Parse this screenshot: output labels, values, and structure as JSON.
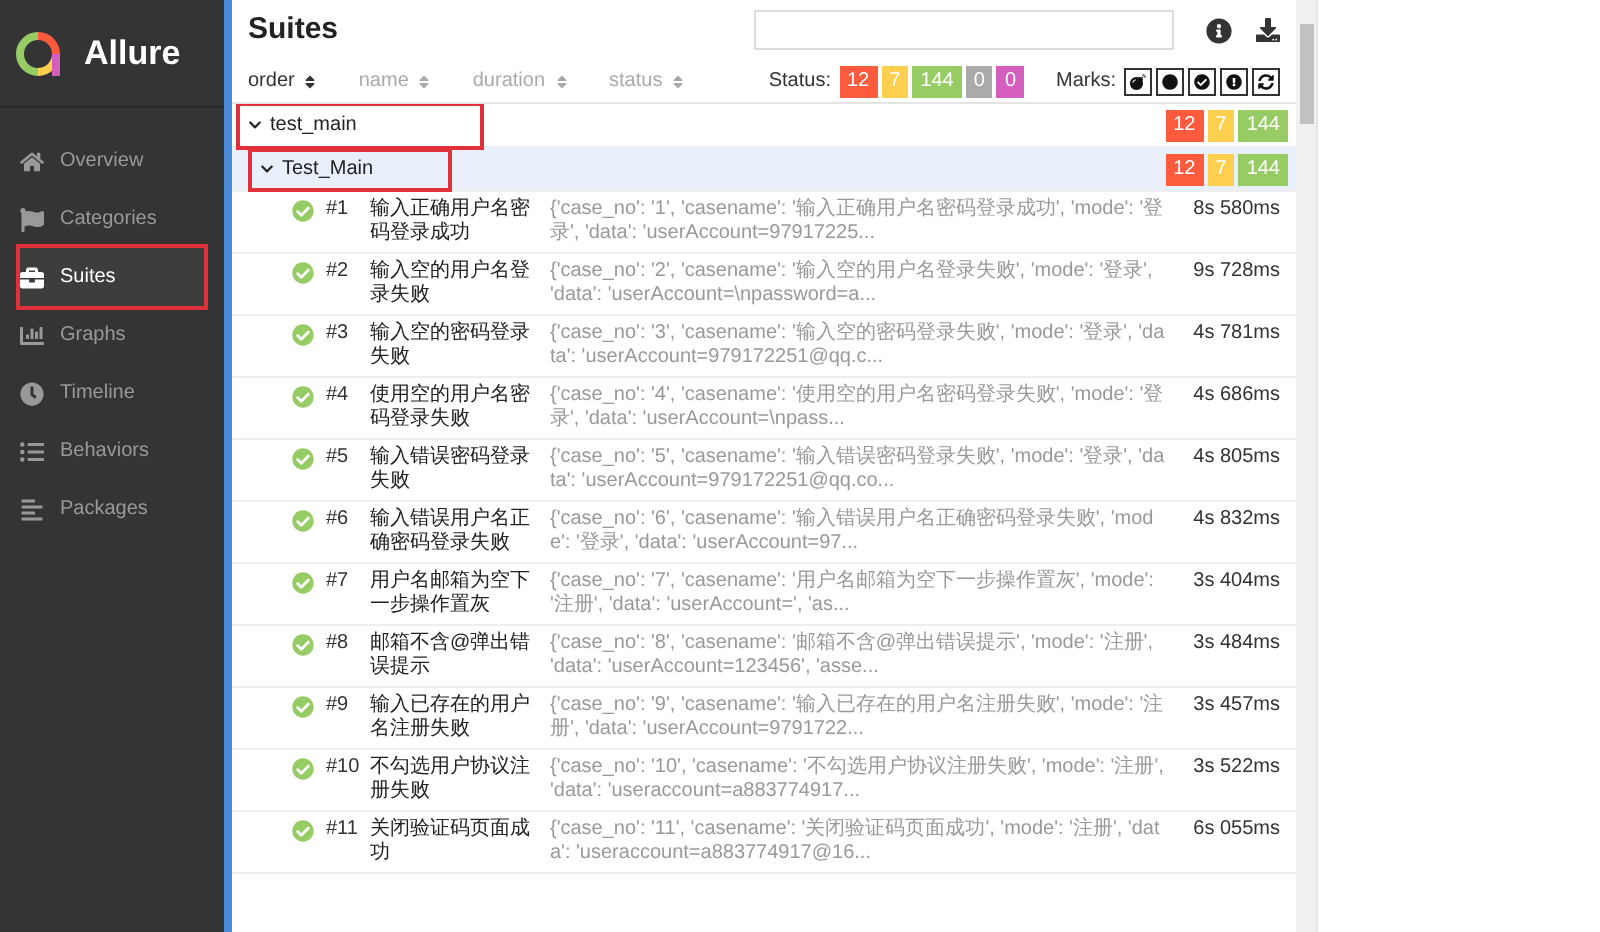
{
  "sidebar": {
    "logo": "Allure",
    "items": [
      {
        "label": "Overview",
        "selected": false,
        "annotated": false
      },
      {
        "label": "Categories",
        "selected": false,
        "annotated": false
      },
      {
        "label": "Suites",
        "selected": true,
        "annotated": true
      },
      {
        "label": "Graphs",
        "selected": false,
        "annotated": false
      },
      {
        "label": "Timeline",
        "selected": false,
        "annotated": false
      },
      {
        "label": "Behaviors",
        "selected": false,
        "annotated": false
      },
      {
        "label": "Packages",
        "selected": false,
        "annotated": false
      }
    ]
  },
  "title": "Suites",
  "sort_columns": [
    {
      "label": "order",
      "active": true
    },
    {
      "label": "name",
      "active": false
    },
    {
      "label": "duration",
      "active": false
    },
    {
      "label": "status",
      "active": false
    }
  ],
  "status_filter": {
    "label": "Status:",
    "counts": [
      {
        "value": "12",
        "kind": "failed"
      },
      {
        "value": "7",
        "kind": "broken"
      },
      {
        "value": "144",
        "kind": "passed"
      },
      {
        "value": "0",
        "kind": "skipped"
      },
      {
        "value": "0",
        "kind": "unknown"
      }
    ]
  },
  "marks": {
    "label": "Marks:",
    "items": [
      {
        "kind": "flaky"
      },
      {
        "kind": "new-failed"
      },
      {
        "kind": "new-passed"
      },
      {
        "kind": "new-broken"
      },
      {
        "kind": "retries"
      }
    ]
  },
  "tree": [
    {
      "name": "test_main",
      "expanded": true,
      "annotated": true,
      "counts": [
        {
          "value": "12",
          "kind": "failed"
        },
        {
          "value": "7",
          "kind": "broken"
        },
        {
          "value": "144",
          "kind": "passed"
        }
      ],
      "children": [
        {
          "name": "Test_Main",
          "expanded": true,
          "annotated": true,
          "counts": [
            {
              "value": "12",
              "kind": "failed"
            },
            {
              "value": "7",
              "kind": "broken"
            },
            {
              "value": "144",
              "kind": "passed"
            }
          ],
          "cases": [
            {
              "number": "#1",
              "kind": "passed",
              "title": "输入正确用户名密码登录成功",
              "description": "{'case_no': '1', 'casename': '输入正确用户名密码登录成功', 'mode': '登录', 'data': 'userAccount=97917225...",
              "duration": "8s 580ms"
            },
            {
              "number": "#2",
              "kind": "passed",
              "title": "输入空的用户名登录失败",
              "description": "{'case_no': '2', 'casename': '输入空的用户名登录失败', 'mode': '登录', 'data': 'userAccount=\\npassword=a...",
              "duration": "9s 728ms"
            },
            {
              "number": "#3",
              "kind": "passed",
              "title": "输入空的密码登录失败",
              "description": "{'case_no': '3', 'casename': '输入空的密码登录失败', 'mode': '登录', 'data': 'userAccount=979172251@qq.c...",
              "duration": "4s 781ms"
            },
            {
              "number": "#4",
              "kind": "passed",
              "title": "使用空的用户名密码登录失败",
              "description": "{'case_no': '4', 'casename': '使用空的用户名密码登录失败', 'mode': '登录', 'data': 'userAccount=\\npass...",
              "duration": "4s 686ms"
            },
            {
              "number": "#5",
              "kind": "passed",
              "title": "输入错误密码登录失败",
              "description": "{'case_no': '5', 'casename': '输入错误密码登录失败', 'mode': '登录', 'data': 'userAccount=979172251@qq.co...",
              "duration": "4s 805ms"
            },
            {
              "number": "#6",
              "kind": "passed",
              "title": "输入错误用户名正确密码登录失败",
              "description": "{'case_no': '6', 'casename': '输入错误用户名正确密码登录失败', 'mode': '登录', 'data': 'userAccount=97...",
              "duration": "4s 832ms"
            },
            {
              "number": "#7",
              "kind": "passed",
              "title": "用户名邮箱为空下一步操作置灰",
              "description": "{'case_no': '7', 'casename': '用户名邮箱为空下一步操作置灰', 'mode': '注册', 'data': 'userAccount=', 'as...",
              "duration": "3s 404ms"
            },
            {
              "number": "#8",
              "kind": "passed",
              "title": "邮箱不含@弹出错误提示",
              "description": "{'case_no': '8', 'casename': '邮箱不含@弹出错误提示', 'mode': '注册', 'data': 'userAccount=123456', 'asse...",
              "duration": "3s 484ms"
            },
            {
              "number": "#9",
              "kind": "passed",
              "title": "输入已存在的用户名注册失败",
              "description": "{'case_no': '9', 'casename': '输入已存在的用户名注册失败', 'mode': '注册', 'data': 'userAccount=9791722...",
              "duration": "3s 457ms"
            },
            {
              "number": "#10",
              "kind": "passed",
              "title": "不勾选用户协议注册失败",
              "description": "{'case_no': '10', 'casename': '不勾选用户协议注册失败', 'mode': '注册', 'data': 'useraccount=a883774917...",
              "duration": "3s 522ms"
            },
            {
              "number": "#11",
              "kind": "passed",
              "title": "关闭验证码页面成功",
              "description": "{'case_no': '11', 'casename': '关闭验证码页面成功', 'mode': '注册', 'data': 'useraccount=a883774917@16...",
              "duration": "6s 055ms"
            }
          ]
        }
      ]
    }
  ]
}
